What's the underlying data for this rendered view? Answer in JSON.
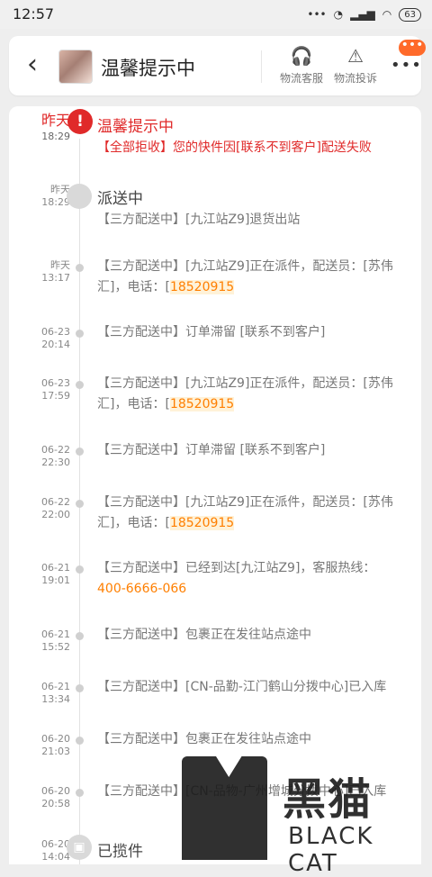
{
  "status": {
    "time": "12:57",
    "battery": "63",
    "icons": [
      "more-dots-icon",
      "alarm-icon",
      "hd-icon",
      "signal-icon",
      "wifi-icon",
      "battery-icon"
    ]
  },
  "header": {
    "title": "温馨提示中",
    "back_icon": "chevron-left-icon",
    "service_label": "物流客服",
    "complaint_label": "物流投诉",
    "more_badge": "•••",
    "accent": "#ff6a2a"
  },
  "timeline": [
    {
      "time_top": "昨天",
      "time_bottom": "18:29",
      "title": "温馨提示中",
      "text_prefix": "【全部拒收】",
      "text": "您的快件因[联系不到客户]配送失败"
    },
    {
      "time_top": "昨天",
      "time_bottom": "18:29",
      "title": "派送中",
      "text": "【三方配送中】[九江站Z9]退货出站"
    },
    {
      "time_top": "昨天",
      "time_bottom": "13:17",
      "text": "【三方配送中】[九江站Z9]正在派件，配送员：[苏伟汇]，电话：[",
      "phone": "18520915"
    },
    {
      "time_top": "06-23",
      "time_bottom": "20:14",
      "text": "【三方配送中】订单滞留 [联系不到客户]"
    },
    {
      "time_top": "06-23",
      "time_bottom": "17:59",
      "text": "【三方配送中】[九江站Z9]正在派件，配送员：[苏伟汇]，电话：[",
      "phone": "18520915"
    },
    {
      "time_top": "06-22",
      "time_bottom": "22:30",
      "text": "【三方配送中】订单滞留 [联系不到客户]"
    },
    {
      "time_top": "06-22",
      "time_bottom": "22:00",
      "text": "【三方配送中】[九江站Z9]正在派件，配送员：[苏伟汇]，电话：[",
      "phone": "18520915"
    },
    {
      "time_top": "06-21",
      "time_bottom": "19:01",
      "text": "【三方配送中】已经到达[九江站Z9]，客服热线：",
      "hotline": "400-6666-066"
    },
    {
      "time_top": "06-21",
      "time_bottom": "15:52",
      "text": "【三方配送中】包裹正在发往站点途中"
    },
    {
      "time_top": "06-21",
      "time_bottom": "13:34",
      "text": "【三方配送中】[CN-品勤-江门鹤山分拨中心]已入库"
    },
    {
      "time_top": "06-20",
      "time_bottom": "21:03",
      "text": "【三方配送中】包裹正在发往站点途中"
    },
    {
      "time_top": "06-20",
      "time_bottom": "20:58",
      "text": "【三方配送中】[CN-品物-广州增城分拨中心]已入库"
    },
    {
      "time_top": "06-20",
      "time_bottom": "14:04",
      "title": "已揽件"
    }
  ],
  "watermark": {
    "cn": "黑猫",
    "en": "BLACK CAT"
  }
}
